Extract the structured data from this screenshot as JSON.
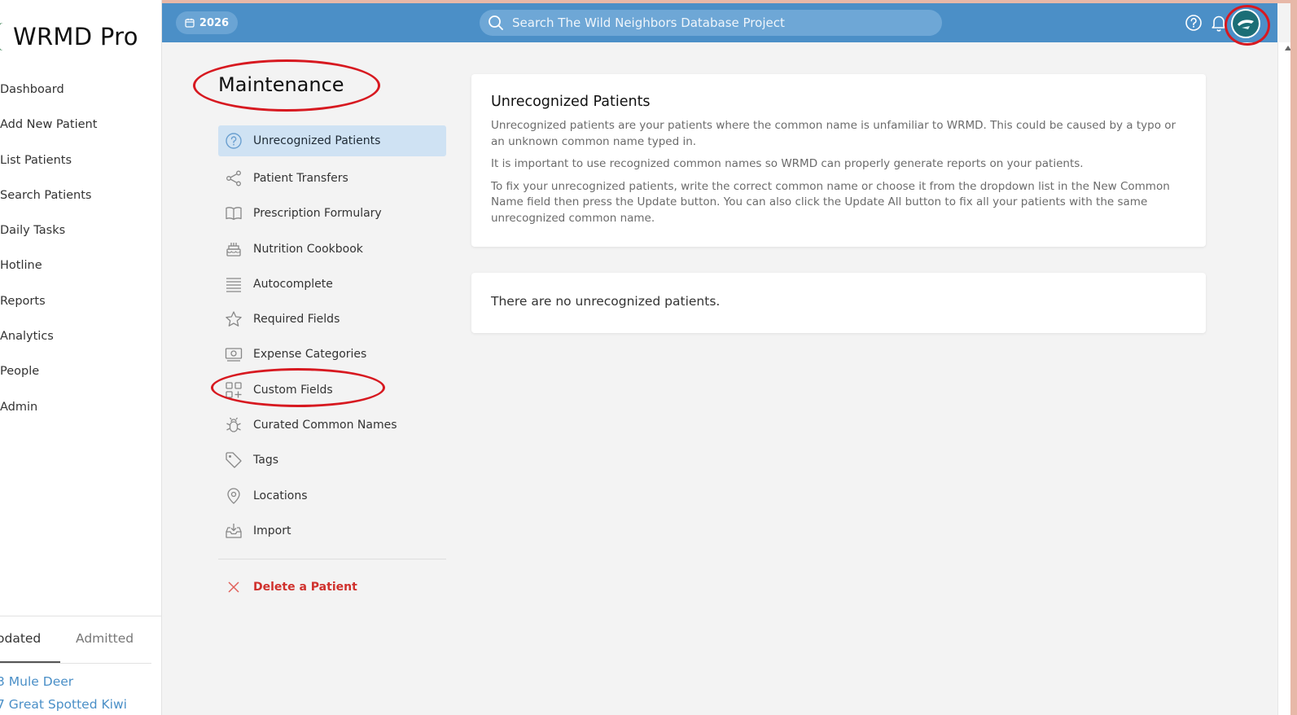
{
  "app": {
    "name": "WRMD Pro",
    "nav": [
      "Dashboard",
      "Add New Patient",
      "List Patients",
      "Search Patients",
      "Daily Tasks",
      "Hotline",
      "Reports",
      "Analytics",
      "People",
      "Admin"
    ],
    "tabs": [
      "odated",
      "Admitted"
    ],
    "active_tab": "odated",
    "recent_patients": [
      "3 Mule Deer",
      "7 Great Spotted Kiwi"
    ]
  },
  "topbar": {
    "year": "2026",
    "search_placeholder": "Search The Wild Neighbors Database Project",
    "icons": [
      "calendar-icon",
      "search-icon",
      "help-icon",
      "bell-icon",
      "avatar"
    ]
  },
  "maintenance": {
    "title": "Maintenance",
    "items": [
      {
        "label": "Unrecognized Patients",
        "icon": "question-circle-icon",
        "active": true
      },
      {
        "label": "Patient Transfers",
        "icon": "share-icon"
      },
      {
        "label": "Prescription Formulary",
        "icon": "book-icon"
      },
      {
        "label": "Nutrition Cookbook",
        "icon": "cake-icon"
      },
      {
        "label": "Autocomplete",
        "icon": "list-lines-icon"
      },
      {
        "label": "Required Fields",
        "icon": "star-icon"
      },
      {
        "label": "Expense Categories",
        "icon": "cash-icon"
      },
      {
        "label": "Custom Fields",
        "icon": "squares-plus-icon"
      },
      {
        "label": "Curated Common Names",
        "icon": "bug-icon"
      },
      {
        "label": "Tags",
        "icon": "tag-icon"
      },
      {
        "label": "Locations",
        "icon": "map-pin-icon"
      },
      {
        "label": "Import",
        "icon": "inbox-in-icon"
      }
    ],
    "delete_label": "Delete a Patient"
  },
  "info_card": {
    "title": "Unrecognized Patients",
    "paragraphs": [
      "Unrecognized patients are your patients where the common name is unfamiliar to WRMD. This could be caused by a typo or an unknown common name typed in.",
      "It is important to use recognized common names so WRMD can properly generate reports on your patients.",
      "To fix your unrecognized patients, write the correct common name or choose it from the dropdown list in the New Common Name field then press the Update button. You can also click the Update All button to fix all your patients with the same unrecognized common name."
    ]
  },
  "empty_card": {
    "message": "There are no unrecognized patients."
  },
  "colors": {
    "topbar": "#4b8fc7",
    "active_nav_bg": "#cfe2f3",
    "danger": "#d0312d",
    "link": "#4a8fc7",
    "annotation": "#d71920"
  }
}
